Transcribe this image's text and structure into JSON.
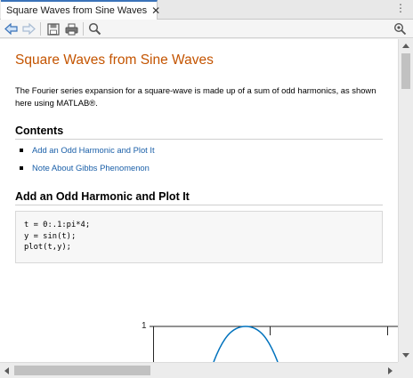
{
  "tab": {
    "title": "Square Waves from Sine Waves",
    "close_glyph": "✕"
  },
  "tab_menu_glyph": "⋮",
  "toolbar": {
    "back_icon": "back-arrow-icon",
    "forward_icon": "forward-arrow-icon",
    "save_icon": "save-icon",
    "print_icon": "print-icon",
    "find_icon": "search-icon",
    "options_icon": "find-options-icon"
  },
  "page": {
    "title": "Square Waves from Sine Waves",
    "intro": "The Fourier series expansion for a square-wave is made up of a sum of odd harmonics, as shown here using MATLAB®.",
    "contents_heading": "Contents",
    "toc": [
      "Add an Odd Harmonic and Plot It",
      "Note About Gibbs Phenomenon"
    ],
    "section_heading": "Add an Odd Harmonic and Plot It",
    "code": [
      "t = 0:.1:pi*4;",
      "y = sin(t);",
      "plot(t,y);"
    ],
    "plot_ytick": "1"
  },
  "colors": {
    "title": "#c45400",
    "link": "#1a5fa8",
    "curve": "#0072bd",
    "tab_accent": "#3b73b9"
  }
}
